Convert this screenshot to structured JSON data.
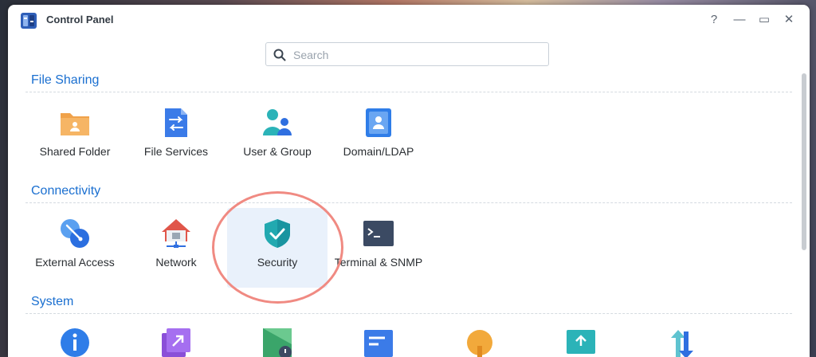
{
  "window": {
    "title": "Control Panel",
    "help": "?",
    "minimize": "—",
    "maximize": "▭",
    "close": "✕"
  },
  "search": {
    "placeholder": "Search"
  },
  "sections": [
    {
      "title": "File Sharing",
      "items": [
        {
          "label": "Shared Folder",
          "icon": "shared-folder-icon"
        },
        {
          "label": "File Services",
          "icon": "file-services-icon"
        },
        {
          "label": "User & Group",
          "icon": "user-group-icon"
        },
        {
          "label": "Domain/LDAP",
          "icon": "domain-ldap-icon"
        }
      ]
    },
    {
      "title": "Connectivity",
      "items": [
        {
          "label": "External Access",
          "icon": "external-access-icon"
        },
        {
          "label": "Network",
          "icon": "network-icon"
        },
        {
          "label": "Security",
          "icon": "security-shield-icon",
          "selected": true
        },
        {
          "label": "Terminal & SNMP",
          "icon": "terminal-icon"
        }
      ]
    },
    {
      "title": "System"
    }
  ],
  "colors": {
    "accent": "#1a6fd0",
    "selected_bg": "#e9f1fb",
    "highlight": "#f08a82"
  }
}
